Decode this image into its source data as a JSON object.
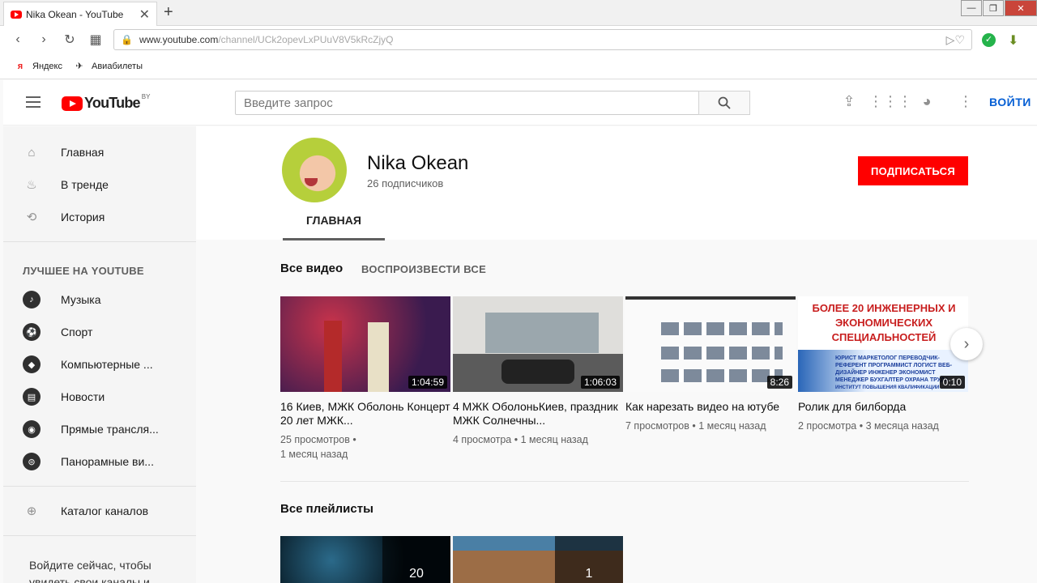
{
  "browser": {
    "tab_title": "Nika Okean - YouTube",
    "tab_close": "✕",
    "new_tab": "+",
    "url_host": "www.youtube.com",
    "url_path": "/channel/UCk2opevLxPUuV8V5kRcZjyQ",
    "bookmarks": [
      {
        "icon": "я",
        "label": "Яндекс"
      },
      {
        "icon": "✈",
        "label": "Авиабилеты"
      }
    ]
  },
  "header": {
    "logo_text": "YouTube",
    "logo_region": "BY",
    "search_placeholder": "Введите запрос",
    "signin": "ВОЙТИ"
  },
  "sidebar": {
    "top_items": [
      {
        "label": "Главная",
        "icon": "home-icon"
      },
      {
        "label": "В тренде",
        "icon": "flame-icon"
      },
      {
        "label": "История",
        "icon": "history-icon"
      }
    ],
    "best_heading": "ЛУЧШЕЕ НА YOUTUBE",
    "best_items": [
      {
        "label": "Музыка",
        "icon": "music-icon"
      },
      {
        "label": "Спорт",
        "icon": "sport-icon"
      },
      {
        "label": "Компьютерные ...",
        "icon": "gaming-icon"
      },
      {
        "label": "Новости",
        "icon": "news-icon"
      },
      {
        "label": "Прямые трансля...",
        "icon": "live-icon"
      },
      {
        "label": "Панорамные ви...",
        "icon": "360-icon"
      }
    ],
    "catalog": "Каталог каналов",
    "signin_note": "Войдите сейчас, чтобы увидеть свои каналы и рекомендации!"
  },
  "channel": {
    "name": "Nika Okean",
    "subscribers": "26 подписчиков",
    "subscribe_button": "ПОДПИСАТЬСЯ",
    "tab_home": "ГЛАВНАЯ"
  },
  "videos_section": {
    "title": "Все видео",
    "play_all": "ВОСПРОИЗВЕСТИ ВСЕ",
    "videos": [
      {
        "title": "16 Киев, МЖК Оболонь Концерт 20 лет МЖК...",
        "duration": "1:04:59",
        "views": "25 просмотров",
        "age": "1 месяц назад"
      },
      {
        "title": "4 МЖК ОболоньКиев, праздник МЖК Солнечны...",
        "duration": "1:06:03",
        "views": "4 просмотра",
        "age": "1 месяц назад"
      },
      {
        "title": "Как нарезать видео на ютубе",
        "duration": "8:26",
        "views": "7 просмотров",
        "age": "1 месяц назад"
      },
      {
        "title": "Ролик для билборда",
        "duration": "0:10",
        "views": "2 просмотра",
        "age": "3 месяца назад"
      }
    ],
    "thumb4_headline": "БОЛЕЕ 20 ИНЖЕНЕРНЫХ И ЭКОНОМИЧЕСКИХ СПЕЦИАЛЬНОСТЕЙ",
    "thumb4_jobs": "ЮРИСТ МАРКЕТОЛОГ ПЕРЕВОДЧИК-РЕФЕРЕНТ ПРОГРАММИСТ ЛОГИСТ ВЕБ-ДИЗАЙНЕР ИНЖЕНЕР ЭКОНОМИСТ МЕНЕДЖЕР БУХГАЛТЕР ОХРАНА ТРУДА",
    "thumb4_footer": "ИНСТИТУТ ПОВЫШЕНИЯ КВАЛИФИКАЦИИ"
  },
  "playlists_section": {
    "title": "Все плейлисты",
    "playlists": [
      {
        "count": "20"
      },
      {
        "count": "1"
      }
    ]
  },
  "colors": {
    "brand_red": "#ff0000",
    "link_blue": "#065fd4"
  }
}
